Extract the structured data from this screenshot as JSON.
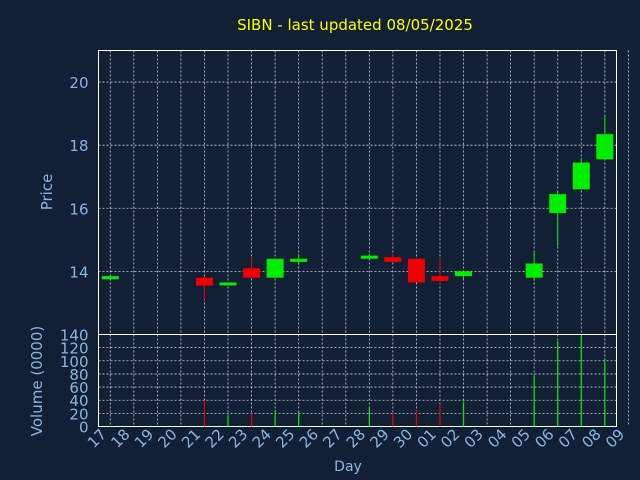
{
  "title": "SIBN - last updated 08/05/2025",
  "colors": {
    "background": "#112035",
    "title": "#ffff00",
    "axis_text": "#8db4e2",
    "frame": "#ffffff",
    "grid": "#ffffff",
    "up": "#00ee00",
    "down": "#ee0000"
  },
  "chart_data": [
    {
      "type": "candlestick",
      "ylabel": "Price",
      "ylim": [
        12,
        21
      ],
      "yticks": [
        "20",
        "18",
        "16",
        "14"
      ],
      "grid": true,
      "x": [
        "17",
        "18",
        "19",
        "20",
        "21",
        "22",
        "23",
        "24",
        "25",
        "26",
        "27",
        "28",
        "29",
        "30",
        "01",
        "02",
        "03",
        "04",
        "05",
        "06",
        "07",
        "08",
        "09"
      ],
      "candles": [
        {
          "day": "17",
          "open": 13.75,
          "close": 13.85,
          "high": 13.85,
          "low": 13.75
        },
        {
          "day": "21",
          "open": 13.8,
          "close": 13.55,
          "high": 13.85,
          "low": 13.1
        },
        {
          "day": "22",
          "open": 13.6,
          "close": 13.65,
          "high": 13.65,
          "low": 13.55
        },
        {
          "day": "23",
          "open": 14.1,
          "close": 13.8,
          "high": 14.45,
          "low": 13.8
        },
        {
          "day": "24",
          "open": 13.8,
          "close": 14.4,
          "high": 14.4,
          "low": 13.8
        },
        {
          "day": "25",
          "open": 14.3,
          "close": 14.4,
          "high": 14.55,
          "low": 14.2
        },
        {
          "day": "28",
          "open": 14.4,
          "close": 14.5,
          "high": 14.55,
          "low": 14.4
        },
        {
          "day": "29",
          "open": 14.45,
          "close": 14.3,
          "high": 14.55,
          "low": 14.3
        },
        {
          "day": "30",
          "open": 14.4,
          "close": 13.65,
          "high": 14.4,
          "low": 13.65
        },
        {
          "day": "01",
          "open": 13.85,
          "close": 13.7,
          "high": 14.4,
          "low": 13.6
        },
        {
          "day": "02",
          "open": 13.85,
          "close": 14.0,
          "high": 14.0,
          "low": 13.75
        },
        {
          "day": "05",
          "open": 13.8,
          "close": 14.25,
          "high": 14.6,
          "low": 13.7
        },
        {
          "day": "06",
          "open": 15.85,
          "close": 16.45,
          "high": 16.5,
          "low": 14.8
        },
        {
          "day": "07",
          "open": 16.6,
          "close": 17.45,
          "high": 17.6,
          "low": 16.6
        },
        {
          "day": "08",
          "open": 17.55,
          "close": 18.35,
          "high": 18.95,
          "low": 17.55
        }
      ]
    },
    {
      "type": "bar",
      "ylabel": "Volume (0000)",
      "xlabel": "Day",
      "ylim": [
        0,
        140
      ],
      "yticks": [
        "140",
        "120",
        "100",
        "80",
        "60",
        "40",
        "20",
        "0"
      ],
      "grid": true,
      "x": [
        "17",
        "18",
        "19",
        "20",
        "21",
        "22",
        "23",
        "24",
        "25",
        "26",
        "27",
        "28",
        "29",
        "30",
        "01",
        "02",
        "03",
        "04",
        "05",
        "06",
        "07",
        "08",
        "09"
      ],
      "bars": [
        {
          "day": "17",
          "value": 1,
          "direction": "up"
        },
        {
          "day": "21",
          "value": 40,
          "direction": "down"
        },
        {
          "day": "22",
          "value": 18,
          "direction": "up"
        },
        {
          "day": "23",
          "value": 20,
          "direction": "down"
        },
        {
          "day": "24",
          "value": 25,
          "direction": "up"
        },
        {
          "day": "25",
          "value": 22,
          "direction": "up"
        },
        {
          "day": "28",
          "value": 30,
          "direction": "up"
        },
        {
          "day": "29",
          "value": 22,
          "direction": "down"
        },
        {
          "day": "30",
          "value": 25,
          "direction": "down"
        },
        {
          "day": "01",
          "value": 35,
          "direction": "down"
        },
        {
          "day": "02",
          "value": 38,
          "direction": "up"
        },
        {
          "day": "05",
          "value": 78,
          "direction": "up"
        },
        {
          "day": "06",
          "value": 130,
          "direction": "up"
        },
        {
          "day": "07",
          "value": 138,
          "direction": "up"
        },
        {
          "day": "08",
          "value": 100,
          "direction": "up"
        }
      ]
    }
  ]
}
